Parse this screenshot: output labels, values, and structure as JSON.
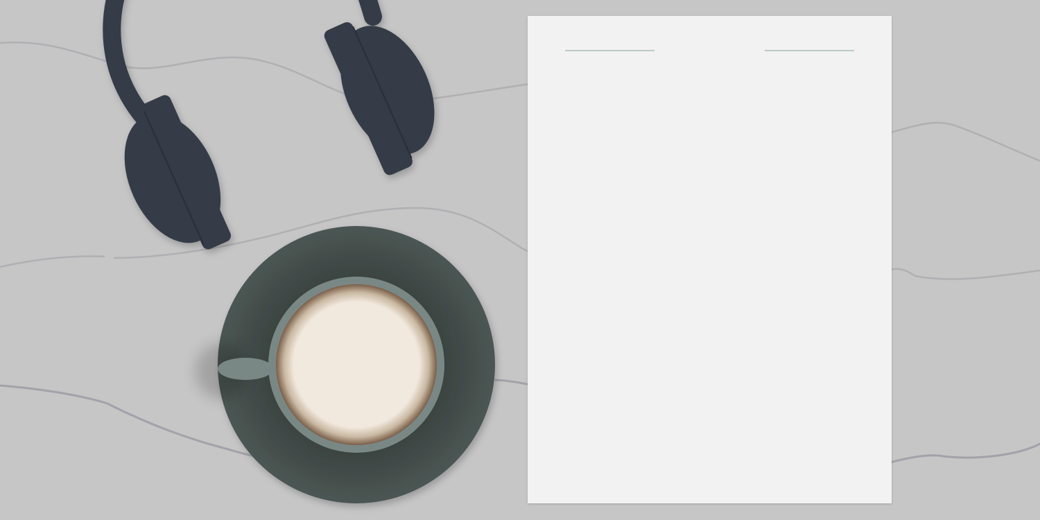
{
  "colors": {
    "desk": "#c6c6c6",
    "cable": "#b0b0b4",
    "cable_dark": "#a2a2aa",
    "headphones": "#353b47",
    "headphones_seam": "#2a2f39",
    "saucer_outer": "#4c5754",
    "saucer_inner": "#3a4340",
    "cup_rim": "#7a8885",
    "coffee_edge": "#7a5e48",
    "coffee_mid": "#c9b8a2",
    "foam": "#f2e9de",
    "paper": "#f2f2f2",
    "paper_rule": "#bccac6"
  },
  "objects": {
    "headphones": {
      "icon": "headphones-icon"
    },
    "coffee": {
      "icon": "coffee-cup-icon"
    },
    "paper": {
      "icon": "blank-paper-sheet"
    }
  }
}
